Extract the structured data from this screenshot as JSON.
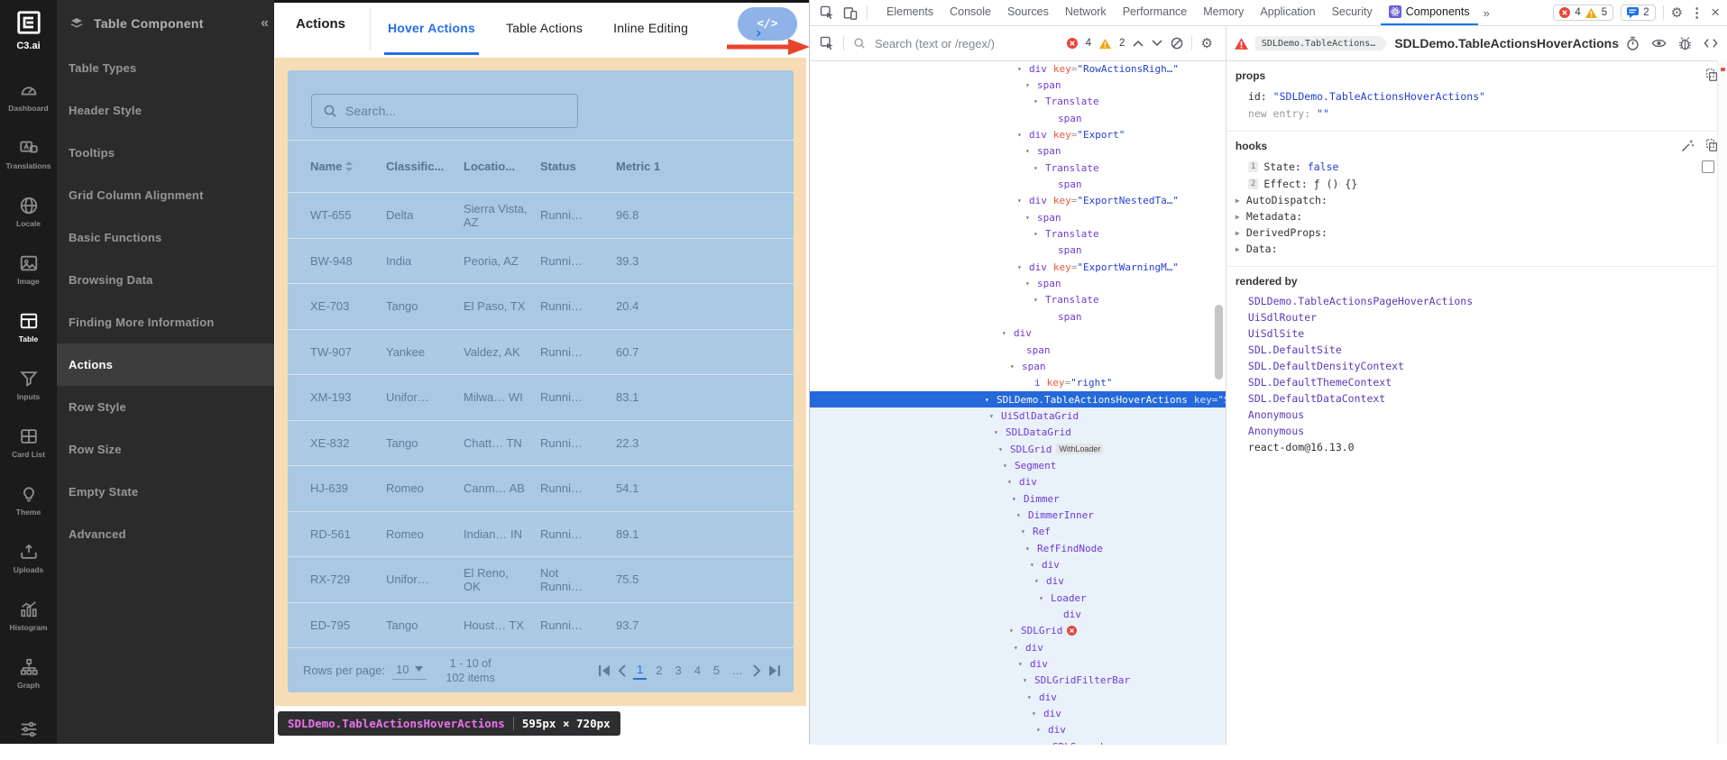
{
  "rail": {
    "logo_text": "C3.ai",
    "items": [
      {
        "label": "Dashboard",
        "icon": "dashboard-icon"
      },
      {
        "label": "Translations",
        "icon": "translate-icon"
      },
      {
        "label": "Locale",
        "icon": "globe-icon"
      },
      {
        "label": "Image",
        "icon": "image-icon"
      },
      {
        "label": "Table",
        "icon": "table-icon",
        "active": true
      },
      {
        "label": "Inputs",
        "icon": "funnel-icon"
      },
      {
        "label": "Card List",
        "icon": "card-list-icon"
      },
      {
        "label": "Theme",
        "icon": "lightbulb-icon"
      },
      {
        "label": "Uploads",
        "icon": "upload-icon"
      },
      {
        "label": "Histogram",
        "icon": "histogram-icon"
      },
      {
        "label": "Graph",
        "icon": "graph-icon"
      },
      {
        "label": "",
        "icon": "sliders-icon"
      }
    ]
  },
  "menu": {
    "title": "Table Component",
    "collapse_glyph": "«",
    "items": [
      "Table Types",
      "Header Style",
      "Tooltips",
      "Grid Column Alignment",
      "Basic Functions",
      "Browsing Data",
      "Finding More Information",
      "Actions",
      "Row Style",
      "Row Size",
      "Empty State",
      "Advanced"
    ],
    "active_item": "Actions"
  },
  "page": {
    "title": "Actions",
    "tabs": [
      "Hover Actions",
      "Table Actions",
      "Inline Editing"
    ],
    "active_tab": "Hover Actions",
    "code_button_label": "</>",
    "grid": {
      "search_placeholder": "Search...",
      "columns": [
        "Name",
        "Classific...",
        "Locatio...",
        "Status",
        "Metric 1"
      ],
      "rows": [
        [
          "WT-655",
          "Delta",
          "Sierra Vista, AZ",
          "Runni…",
          "96.8"
        ],
        [
          "BW-948",
          "India",
          "Peoria, AZ",
          "Runni…",
          "39.3"
        ],
        [
          "XE-703",
          "Tango",
          "El Paso, TX",
          "Runni…",
          "20.4"
        ],
        [
          "TW-907",
          "Yankee",
          "Valdez, AK",
          "Runni…",
          "60.7"
        ],
        [
          "XM-193",
          "Unifor…",
          "Milwa… WI",
          "Runni…",
          "83.1"
        ],
        [
          "XE-832",
          "Tango",
          "Chatt… TN",
          "Runni…",
          "22.3"
        ],
        [
          "HJ-639",
          "Romeo",
          "Canm… AB",
          "Runni…",
          "54.1"
        ],
        [
          "RD-561",
          "Romeo",
          "Indian… IN",
          "Runni…",
          "89.1"
        ],
        [
          "RX-729",
          "Unifor…",
          "El Reno, OK",
          "Not Runni…",
          "75.5"
        ],
        [
          "ED-795",
          "Tango",
          "Houst… TX",
          "Runni…",
          "93.7"
        ]
      ],
      "pagination": {
        "rows_per_page_label": "Rows per page:",
        "rows_per_page_value": "10",
        "range_line1": "1 - 10 of",
        "range_line2": "102 items",
        "pages": [
          "1",
          "2",
          "3",
          "4",
          "5",
          "..."
        ],
        "active_page": "1"
      }
    },
    "overlay_tooltip": {
      "component_name": "SDLDemo.TableActionsHoverActions",
      "dimensions": "595px × 720px"
    }
  },
  "devtools": {
    "tabs": [
      "Elements",
      "Console",
      "Sources",
      "Network",
      "Performance",
      "Memory",
      "Application",
      "Security",
      "Components"
    ],
    "active_tab": "Components",
    "more_tabs_glyph": "»",
    "toolbar_badges": {
      "errors": "4",
      "warnings": "5",
      "issues": "2"
    },
    "components_search": {
      "placeholder": "Search (text or /regex/)",
      "errors": "4",
      "warnings": "2"
    },
    "tree": {
      "lines": [
        {
          "name": "div",
          "key": "RowActionsRigh…",
          "indent": 230
        },
        {
          "name": "span",
          "indent": 239
        },
        {
          "name": "Translate",
          "indent": 248
        },
        {
          "name": "span",
          "indent": 262,
          "leaf": true
        },
        {
          "name": "div",
          "key": "Export",
          "indent": 230
        },
        {
          "name": "span",
          "indent": 239
        },
        {
          "name": "Translate",
          "indent": 248
        },
        {
          "name": "span",
          "indent": 262,
          "leaf": true
        },
        {
          "name": "div",
          "key": "ExportNestedTa…",
          "indent": 230
        },
        {
          "name": "span",
          "indent": 239
        },
        {
          "name": "Translate",
          "indent": 248
        },
        {
          "name": "span",
          "indent": 262,
          "leaf": true
        },
        {
          "name": "div",
          "key": "ExportWarningM…",
          "indent": 230
        },
        {
          "name": "span",
          "indent": 239
        },
        {
          "name": "Translate",
          "indent": 248
        },
        {
          "name": "span",
          "indent": 262,
          "leaf": true
        },
        {
          "name": "div",
          "indent": 213
        },
        {
          "name": "span",
          "indent": 227,
          "leaf": true
        },
        {
          "name": "span",
          "indent": 222
        },
        {
          "name": "i",
          "key": "right",
          "indent": 236,
          "leaf": true
        },
        {
          "name": "SDLDemo.TableActionsHoverActions",
          "key": "SDLDemo.TableA…",
          "indent": 194,
          "selected": true
        },
        {
          "name": "UiSdlDataGrid",
          "indent": 199,
          "tint": true
        },
        {
          "name": "SDLDataGrid",
          "indent": 204,
          "tint": true
        },
        {
          "name": "SDLGrid",
          "badge": "WithLoader",
          "indent": 209,
          "tint": true
        },
        {
          "name": "Segment",
          "indent": 214,
          "tint": true
        },
        {
          "name": "div",
          "indent": 219,
          "tint": true
        },
        {
          "name": "Dimmer",
          "indent": 224,
          "tint": true
        },
        {
          "name": "DimmerInner",
          "indent": 229,
          "tint": true
        },
        {
          "name": "Ref",
          "indent": 234,
          "tint": true
        },
        {
          "name": "RefFindNode",
          "indent": 239,
          "tint": true
        },
        {
          "name": "div",
          "indent": 244,
          "tint": true
        },
        {
          "name": "div",
          "indent": 249,
          "tint": true
        },
        {
          "name": "Loader",
          "indent": 254,
          "tint": true
        },
        {
          "name": "div",
          "indent": 268,
          "leaf": true,
          "tint": true
        },
        {
          "name": "SDLGrid",
          "error_badge": true,
          "indent": 221,
          "tint": true
        },
        {
          "name": "div",
          "indent": 226,
          "tint": true
        },
        {
          "name": "div",
          "indent": 231,
          "tint": true
        },
        {
          "name": "SDLGridFilterBar",
          "indent": 236,
          "tint": true
        },
        {
          "name": "div",
          "indent": 241,
          "tint": true
        },
        {
          "name": "div",
          "indent": 246,
          "tint": true
        },
        {
          "name": "div",
          "indent": 251,
          "tint": true
        },
        {
          "name": "SDLSearch",
          "indent": 256,
          "tint": true
        }
      ]
    },
    "details": {
      "breadcrumb": "SDLDemo.TableActions…",
      "title": "SDLDemo.TableActionsHoverActions",
      "props": {
        "label": "props",
        "entries": [
          {
            "key": "id",
            "value": "\"SDLDemo.TableActionsHoverActions\""
          },
          {
            "key": "new entry",
            "value": "\"\"",
            "muted": true
          }
        ]
      },
      "hooks": {
        "label": "hooks",
        "entries": [
          {
            "index": "1",
            "name": "State",
            "value": "false",
            "value_kind": "literal",
            "checkbox": true
          },
          {
            "index": "2",
            "name": "Effect",
            "value": "ƒ () {}",
            "value_kind": "function"
          }
        ],
        "groups": [
          "AutoDispatch",
          "Metadata",
          "DerivedProps",
          "Data"
        ]
      },
      "rendered_by": {
        "label": "rendered by",
        "items": [
          "SDLDemo.TableActionsPageHoverActions",
          "UiSdlRouter",
          "UiSdlSite",
          "SDL.DefaultSite",
          "SDL.DefaultDensityContext",
          "SDL.DefaultThemeContext",
          "SDL.DefaultDataContext",
          "Anonymous",
          "Anonymous"
        ],
        "runtime": "react-dom@16.13.0"
      }
    }
  },
  "colors": {
    "accent_blue": "#2670e8",
    "devtools_selection": "#2468da",
    "highlight_content": "#a9c8e3",
    "highlight_margin": "#f6ddb6",
    "error_red": "#e8463c",
    "warning_yellow": "#f2a60d",
    "tree_purple": "#6f3bd1",
    "value_blue": "#2440cc",
    "link_purple": "#5b3ab8",
    "tooltip_pink": "#e873ea"
  }
}
